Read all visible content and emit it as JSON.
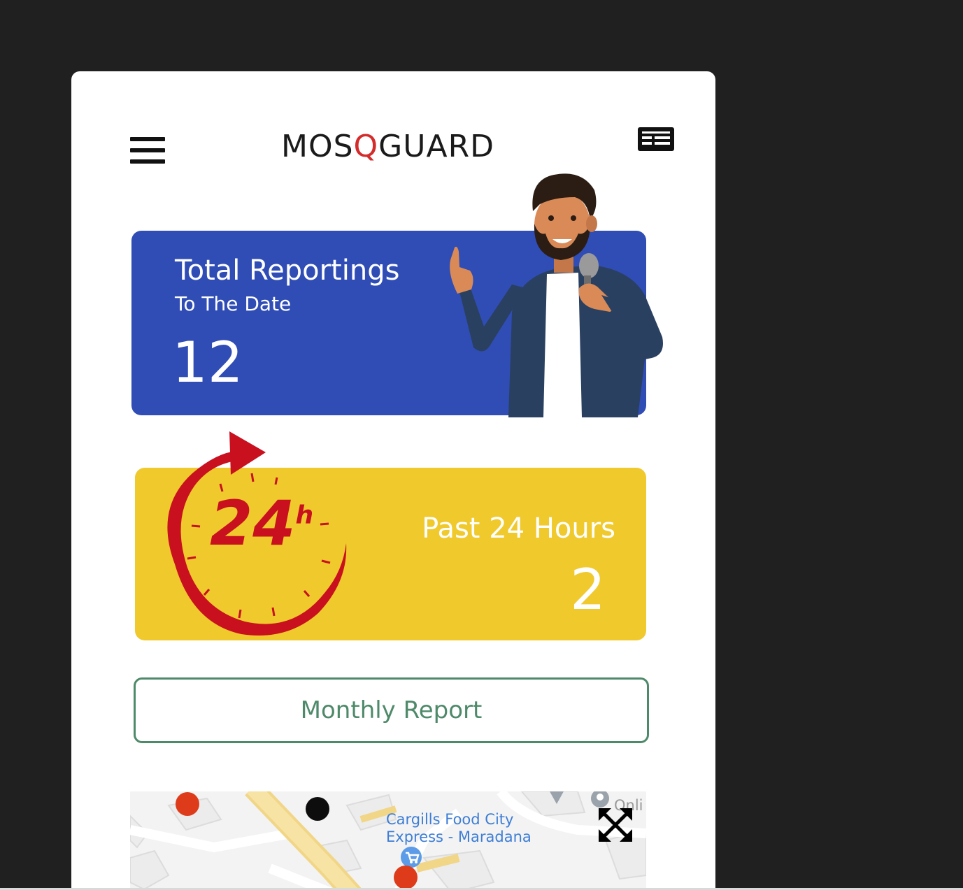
{
  "header": {
    "menu_icon": "hamburger-menu-icon",
    "logo": {
      "before": "MOS",
      "q": "Q",
      "after": "GUARD",
      "q_color": "#d42b2b"
    },
    "news_icon": "news-icon"
  },
  "total_card": {
    "title": "Total Reportings",
    "subtitle": "To The Date",
    "value": "12",
    "color": "#2f4db5"
  },
  "past_card": {
    "title": "Past 24 Hours",
    "value": "2",
    "color": "#f0c92d",
    "clock_label": "24",
    "clock_sup": "h"
  },
  "monthly_button": {
    "label": "Monthly Report",
    "color": "#4e8a6a"
  },
  "map": {
    "place_name_line1": "Cargills Food City",
    "place_name_line2": "Express - Maradana",
    "partial_label": "Onli",
    "expand_icon": "fullscreen-expand-icon",
    "marker_colors": {
      "red": "#de3b1a",
      "black": "#0d0d0d"
    }
  }
}
